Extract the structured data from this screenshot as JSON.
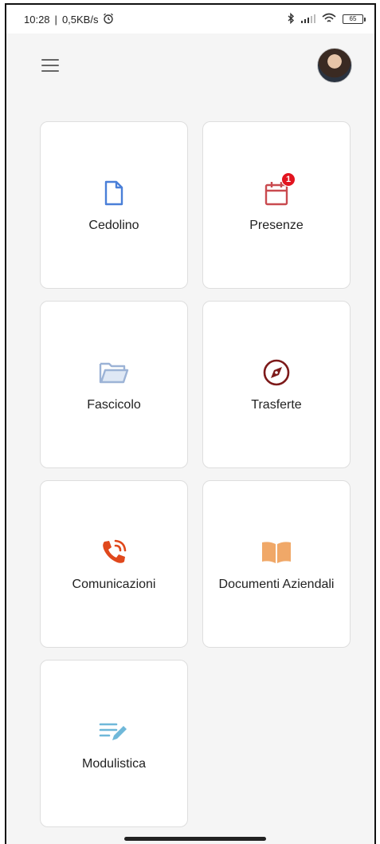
{
  "status_bar": {
    "time": "10:28",
    "separator": "|",
    "net_speed": "0,5KB/s",
    "battery": "65"
  },
  "app_bar": {
    "menu_icon": "menu-icon",
    "avatar_icon": "avatar"
  },
  "tiles": [
    {
      "label": "Cedolino",
      "icon": "document-icon",
      "color": "#4a7fd8"
    },
    {
      "label": "Presenze",
      "icon": "calendar-icon",
      "color": "#c94a4f",
      "badge": "1"
    },
    {
      "label": "Fascicolo",
      "icon": "folder-open-icon",
      "color": "#9cb3d6"
    },
    {
      "label": "Trasferte",
      "icon": "compass-icon",
      "color": "#7d1a1a"
    },
    {
      "label": "Comunicazioni",
      "icon": "phone-ringing-icon",
      "color": "#e0481c"
    },
    {
      "label": "Documenti Aziendali",
      "icon": "book-open-icon",
      "color": "#f0a868"
    },
    {
      "label": "Modulistica",
      "icon": "form-edit-icon",
      "color": "#6fb8d9"
    }
  ],
  "colors": {
    "background": "#f5f5f5",
    "tile_border": "#dedede",
    "badge": "#e2141f"
  }
}
